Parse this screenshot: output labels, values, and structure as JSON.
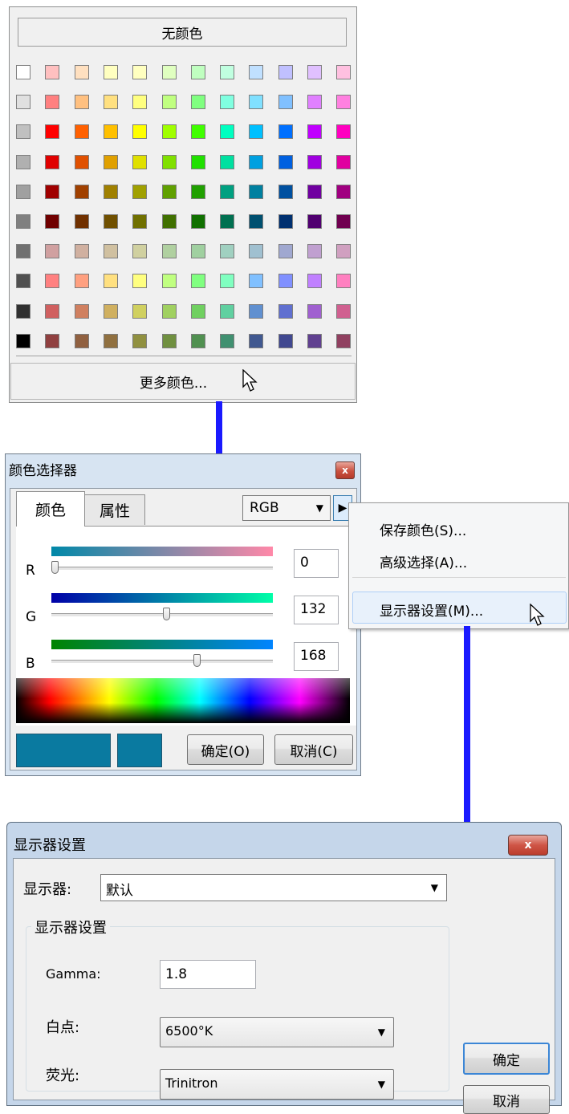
{
  "palette": {
    "no_color_label": "无颜色",
    "more_colors_label": "更多颜色...",
    "swatches": [
      [
        "#ffffff",
        "#ffc0c0",
        "#ffe0c0",
        "#ffffc0",
        "#ffffc0",
        "#e0ffc0",
        "#c0ffc0",
        "#c0ffe0",
        "#c0e0ff",
        "#c0c0ff",
        "#e0c0ff",
        "#ffc0e0"
      ],
      [
        "#e0e0e0",
        "#ff8080",
        "#ffc080",
        "#ffe080",
        "#ffff80",
        "#c0ff80",
        "#80ff80",
        "#80ffe0",
        "#80e0ff",
        "#80c0ff",
        "#e080ff",
        "#ff80e0"
      ],
      [
        "#c0c0c0",
        "#ff0000",
        "#ff6000",
        "#ffc000",
        "#ffff00",
        "#a0ff00",
        "#40ff00",
        "#00ffc0",
        "#00c0ff",
        "#0070ff",
        "#c000ff",
        "#ff00c0"
      ],
      [
        "#b0b0b0",
        "#e00000",
        "#e05000",
        "#e0a000",
        "#e0e000",
        "#80e000",
        "#20e000",
        "#00e0a0",
        "#00a0e0",
        "#0060e0",
        "#a000e0",
        "#e000a0"
      ],
      [
        "#a0a0a0",
        "#a00000",
        "#a04000",
        "#a08000",
        "#a0a000",
        "#60a000",
        "#20a000",
        "#00a080",
        "#0080a0",
        "#0050a0",
        "#7000a0",
        "#a00080"
      ],
      [
        "#808080",
        "#700000",
        "#703000",
        "#705000",
        "#707000",
        "#407000",
        "#107000",
        "#007050",
        "#005070",
        "#003070",
        "#500070",
        "#700050"
      ],
      [
        "#707070",
        "#d0a0a0",
        "#d0b0a0",
        "#d0c0a0",
        "#d0d0a0",
        "#b0d0a0",
        "#a0d0a0",
        "#a0d0c0",
        "#a0c0d0",
        "#a0a8d0",
        "#c0a0d0",
        "#d0a0c0"
      ],
      [
        "#505050",
        "#ff8080",
        "#ffa080",
        "#ffe080",
        "#ffff80",
        "#c0ff80",
        "#80ff80",
        "#80ffc0",
        "#80c0ff",
        "#8090ff",
        "#c080ff",
        "#ff80c0"
      ],
      [
        "#303030",
        "#d06060",
        "#d08060",
        "#d0b060",
        "#d0d060",
        "#a0d060",
        "#70d060",
        "#60d0a0",
        "#6090d0",
        "#6070d0",
        "#a060d0",
        "#d06090"
      ],
      [
        "#000000",
        "#904040",
        "#906040",
        "#907040",
        "#909040",
        "#709040",
        "#509050",
        "#409070",
        "#405890",
        "#404890",
        "#604090",
        "#904060"
      ]
    ]
  },
  "picker": {
    "title": "颜色选择器",
    "close_glyph": "x",
    "tabs": [
      "颜色",
      "属性"
    ],
    "model": "RGB",
    "channels": [
      {
        "label": "R",
        "value": "0",
        "level": 0.0
      },
      {
        "label": "G",
        "value": "132",
        "level": 0.52
      },
      {
        "label": "B",
        "value": "168",
        "level": 0.66
      }
    ],
    "ok_label": "确定(O)",
    "cancel_label": "取消(C)",
    "current_color": "#0a7aa0"
  },
  "menu": {
    "items": [
      "保存颜色(S)...",
      "高级选择(A)...",
      "显示器设置(M)..."
    ]
  },
  "display": {
    "title": "显示器设置",
    "close_glyph": "x",
    "monitor_label": "显示器:",
    "monitor_value": "默认",
    "group_title": "显示器设置",
    "gamma_label": "Gamma:",
    "gamma_value": "1.8",
    "whitepoint_label": "白点:",
    "whitepoint_value": "6500°K",
    "phosphor_label": "荧光:",
    "phosphor_value": "Trinitron",
    "ok_label": "确定",
    "cancel_label": "取消"
  },
  "colors": {
    "arrow": "#1a1aff",
    "accent_swatch": "#0a7aa0"
  }
}
